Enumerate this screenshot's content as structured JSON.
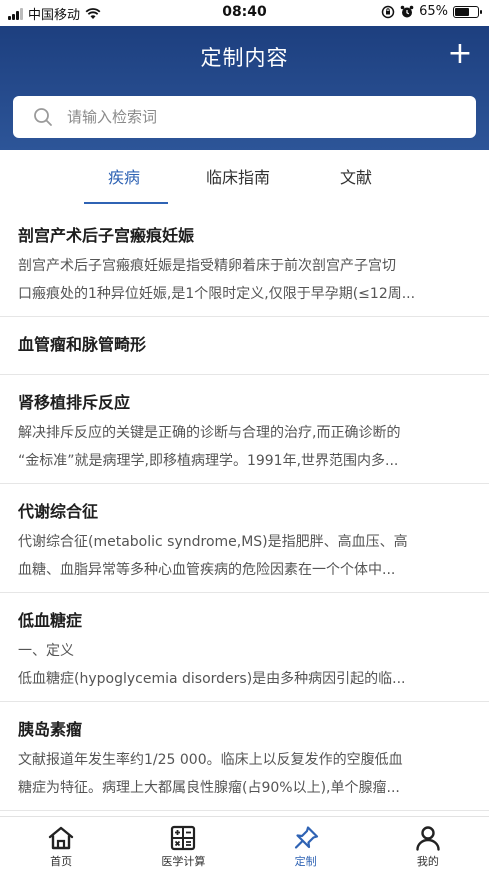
{
  "status": {
    "carrier": "中国移动",
    "time": "08:40",
    "battery": "65%",
    "battery_level": 0.65
  },
  "header": {
    "title": "定制内容",
    "add_label": "+"
  },
  "search": {
    "placeholder": "请输入检索词"
  },
  "tabs": [
    {
      "label": "疾病",
      "active": true
    },
    {
      "label": "临床指南",
      "active": false
    },
    {
      "label": "文献",
      "active": false
    }
  ],
  "items": [
    {
      "title": "剖宫产术后子宫瘢痕妊娠",
      "lines": [
        "剖宫产术后子宫瘢痕妊娠是指受精卵着床于前次剖宫产子宫切",
        "口瘢痕处的1种异位妊娠,是1个限时定义,仅限于早孕期(≤12周..."
      ]
    },
    {
      "title": "血管瘤和脉管畸形",
      "lines": []
    },
    {
      "title": "肾移植排斥反应",
      "lines": [
        "解决排斥反应的关键是正确的诊断与合理的治疗,而正确诊断的",
        "“金标准”就是病理学,即移植病理学。1991年,世界范围内多..."
      ]
    },
    {
      "title": "代谢综合征",
      "lines": [
        "代谢综合征(metabolic syndrome,MS)是指肥胖、高血压、高",
        "血糖、血脂异常等多种心血管疾病的危险因素在一个个体中..."
      ]
    },
    {
      "title": "低血糖症",
      "lines": [
        "一、定义",
        "低血糖症(hypoglycemia disorders)是由多种病因引起的临..."
      ]
    },
    {
      "title": "胰岛素瘤",
      "lines": [
        "文献报道年发生率约1/25 000。临床上以反复发作的空腹低血",
        "糖症为特征。病理上大都属良性腺瘤(占90%以上),单个腺瘤..."
      ]
    }
  ],
  "nav": [
    {
      "label": "首页",
      "icon": "home-icon",
      "active": false
    },
    {
      "label": "医学计算",
      "icon": "calculator-icon",
      "active": false
    },
    {
      "label": "定制",
      "icon": "pin-icon",
      "active": true
    },
    {
      "label": "我的",
      "icon": "user-icon",
      "active": false
    }
  ],
  "colors": {
    "header": "#1d3f7f",
    "accent": "#2f63b4"
  }
}
